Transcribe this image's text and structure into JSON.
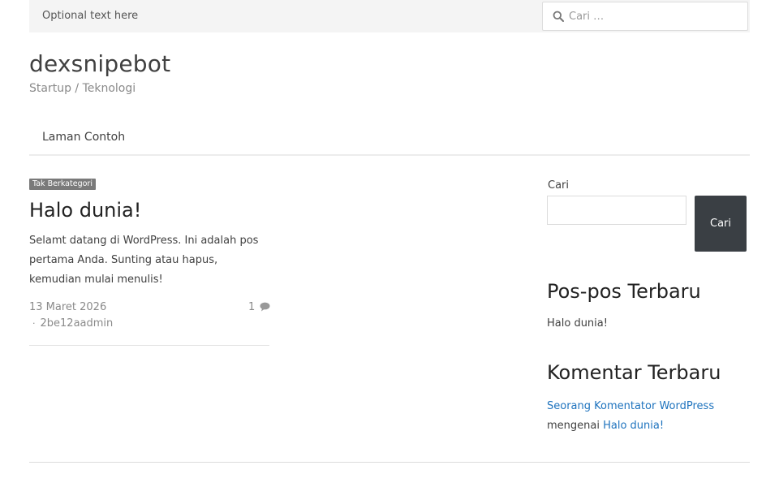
{
  "topbar": {
    "text": "Optional text here",
    "search_placeholder": "Cari …"
  },
  "site": {
    "title": "dexsnipebot",
    "description": "Startup / Teknologi"
  },
  "nav": {
    "items": [
      {
        "label": "Laman Contoh"
      }
    ]
  },
  "post": {
    "category": "Tak Berkategori",
    "title": "Halo dunia!",
    "excerpt": "Selamt datang di WordPress. Ini adalah pos pertama Anda. Sunting atau hapus, kemudian mulai menulis!",
    "date": "13 Maret 2026",
    "comment_count": "1",
    "author_separator": "·",
    "author": "2be12aadmin"
  },
  "sidebar": {
    "search_label": "Cari",
    "search_button": "Cari",
    "recent_posts_title": "Pos-pos Terbaru",
    "recent_posts": [
      {
        "title": "Halo dunia!"
      }
    ],
    "recent_comments_title": "Komentar Terbaru",
    "recent_comment": {
      "author": "Seorang Komentator WordPress",
      "connector": "mengenai",
      "post": "Halo dunia!"
    }
  },
  "colors": {
    "link": "#1e73be",
    "button_bg": "#3a3f44",
    "badge_bg": "#7a7a7a",
    "topbar_bg": "#f4f4f4"
  },
  "icons": {
    "top_search": "search-icon",
    "comments": "comment-bubble-icon"
  }
}
